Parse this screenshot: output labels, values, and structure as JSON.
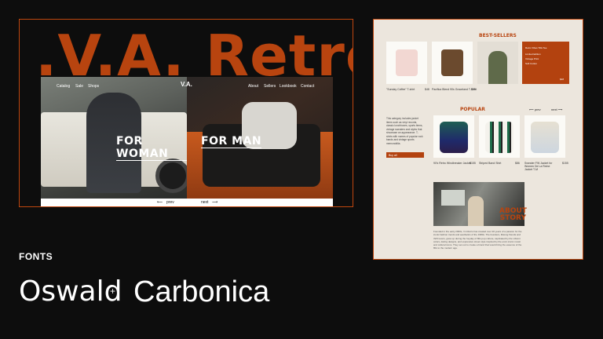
{
  "hero": {
    "brand": ".V.A. Retro.",
    "nav_left": [
      "Catalog",
      "Sale",
      "Shops"
    ],
    "logo": "V.A.",
    "nav_right": [
      "About",
      "Sellers",
      "Lookbook",
      "Contact"
    ],
    "woman_label": "FOR WOMAN",
    "man_label": "FOR MAN",
    "prev": "prev",
    "next": "next",
    "arrow_left": "⟵",
    "arrow_right": "⟶"
  },
  "site": {
    "bestsellers_title": "BEST-SELLERS",
    "bestsellers": [
      {
        "name": "\"Sunday Coffee\" T-shirt",
        "price": "$48"
      },
      {
        "name": "Pacifica Blend 90s Graceland T-Shirt",
        "price": "$25"
      }
    ],
    "popular_title": "POPULAR",
    "popular_prev": "prev",
    "popular_next": "next",
    "popular_text": "This category includes jacket items such as vinyl records, classic lunchboxes, sports items, vintage sweaters and styles that showcase an appearance. T-shirts with names of popular rock bands and vintage sports memorabilia.",
    "popular_button": "Buy all",
    "popular_items": [
      {
        "name": "90's Retro Windbreaker Jacket",
        "price": "$155"
      },
      {
        "name": "Striped Band Shirt",
        "price": "$86"
      },
      {
        "name": "Sweater FW Jacket for Women De La Reine Jacket T-M",
        "price": "$155"
      }
    ],
    "story_title": "ABOUT STORY",
    "story_text": "Founded in the early 2000s, V.A Retro has created over 20 years of a passion for the iconic fashion trends and aesthetics of the 1980s. The founders, lifelong friends and thrift lovers, grew up during the heyday of 80s pop culture, captivated by the vibrant colors, daring designs, and expressive street style inspired by the era's iconic music and cultural icons. They set out to create a brand that would bring the essence of the 80s to the modern age."
  },
  "fonts": {
    "label": "FONTS",
    "font1": "Oswald",
    "plus": "+",
    "font2": "Carbonica"
  },
  "colors": {
    "accent": "#b8440f",
    "background": "#0d0d0d",
    "site_bg": "#ece6dd"
  }
}
